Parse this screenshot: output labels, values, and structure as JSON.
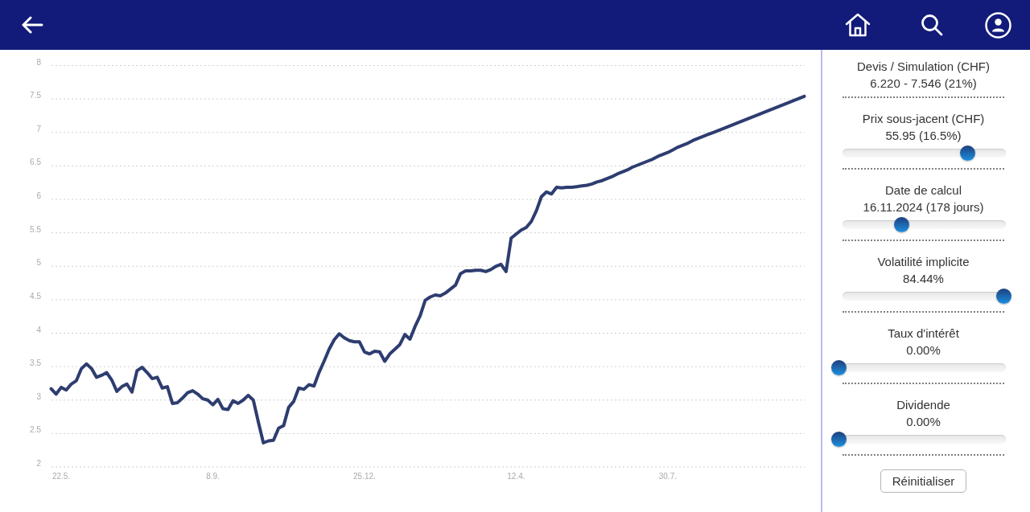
{
  "chart": {
    "chart_data": {
      "type": "line",
      "grid": true,
      "categories": [
        null,
        null,
        "22.5.",
        null,
        null,
        null,
        null,
        null,
        null,
        null,
        null,
        null,
        null,
        null,
        null,
        null,
        null,
        null,
        null,
        null,
        null,
        null,
        null,
        null,
        null,
        null,
        null,
        null,
        null,
        null,
        null,
        null,
        "8.9.",
        null,
        null,
        null,
        null,
        null,
        null,
        null,
        null,
        null,
        null,
        null,
        null,
        null,
        null,
        null,
        null,
        null,
        null,
        null,
        null,
        null,
        null,
        null,
        null,
        null,
        null,
        null,
        null,
        null,
        "25.12.",
        null,
        null,
        null,
        null,
        null,
        null,
        null,
        null,
        null,
        null,
        null,
        null,
        null,
        null,
        null,
        null,
        null,
        null,
        null,
        null,
        null,
        null,
        null,
        null,
        null,
        null,
        null,
        null,
        null,
        "12.4.",
        null,
        null,
        null,
        null,
        null,
        null,
        null,
        null,
        null,
        null,
        null,
        null,
        null,
        null,
        null,
        null,
        null,
        null,
        null,
        null,
        null,
        null,
        null,
        null,
        null,
        null,
        null,
        null,
        null,
        "30.7.",
        null,
        null,
        null,
        null,
        null,
        null,
        null,
        null,
        null,
        null,
        null,
        null,
        null,
        null,
        null,
        null,
        null,
        null,
        null,
        null,
        null,
        null,
        null,
        null,
        null,
        null,
        null
      ],
      "values": [
        3.17,
        3.09,
        3.19,
        3.15,
        3.24,
        3.29,
        3.47,
        3.54,
        3.47,
        3.34,
        3.37,
        3.41,
        3.3,
        3.13,
        3.2,
        3.24,
        3.12,
        3.44,
        3.49,
        3.41,
        3.32,
        3.34,
        3.18,
        3.2,
        2.95,
        2.96,
        3.03,
        3.11,
        3.14,
        3.09,
        3.02,
        3.0,
        2.93,
        3.01,
        2.87,
        2.86,
        2.99,
        2.95,
        3.0,
        3.07,
        3.0,
        2.67,
        2.36,
        2.39,
        2.4,
        2.58,
        2.62,
        2.89,
        2.98,
        3.18,
        3.16,
        3.23,
        3.21,
        3.41,
        3.58,
        3.76,
        3.9,
        3.99,
        3.93,
        3.89,
        3.87,
        3.87,
        3.72,
        3.69,
        3.73,
        3.72,
        3.58,
        3.69,
        3.76,
        3.83,
        3.98,
        3.91,
        4.1,
        4.26,
        4.49,
        4.54,
        4.57,
        4.56,
        4.6,
        4.66,
        4.72,
        4.89,
        4.93,
        4.93,
        4.94,
        4.94,
        4.92,
        4.95,
        5.0,
        5.03,
        4.92,
        5.42,
        5.48,
        5.54,
        5.58,
        5.67,
        5.83,
        6.04,
        6.11,
        6.08,
        6.18,
        6.17,
        6.18,
        6.18,
        6.19,
        6.2,
        6.21,
        6.23,
        6.26,
        6.28,
        6.31,
        6.34,
        6.38,
        6.41,
        6.44,
        6.48,
        6.51,
        6.54,
        6.57,
        6.6,
        6.64,
        6.67,
        6.7,
        6.74,
        6.78,
        6.81,
        6.84,
        6.88,
        6.91,
        6.94,
        6.97,
        7.0,
        7.03,
        7.06,
        7.09,
        7.12,
        7.15,
        7.18,
        7.21,
        7.24,
        7.27,
        7.3,
        7.33,
        7.36,
        7.39,
        7.42,
        7.45,
        7.48,
        7.51,
        7.54
      ],
      "ylim": [
        2,
        8
      ],
      "yticks": [
        2,
        2.5,
        3,
        3.5,
        4,
        4.5,
        5,
        5.5,
        6,
        6.5,
        7,
        7.5,
        8
      ]
    }
  },
  "panel": {
    "sections": [
      {
        "kind": "readout",
        "title": "Devis / Simulation (CHF)",
        "value": "6.220 - 7.546 (21%)"
      },
      {
        "kind": "slider",
        "title": "Prix sous-jacent (CHF)",
        "value": "55.95 (16.5%)",
        "level": 0.78
      },
      {
        "kind": "slider",
        "title": "Date de calcul",
        "value": "16.11.2024 (178 jours)",
        "level": 0.38
      },
      {
        "kind": "slider",
        "title": "Volatilité implicite",
        "value": "84.44%",
        "level": 1.0
      },
      {
        "kind": "slider",
        "title": "Taux d'intérêt",
        "value": "0.00%",
        "level": 0
      },
      {
        "kind": "slider",
        "title": "Dividende",
        "value": "0.00%",
        "level": 0
      }
    ],
    "reset_button": "Réinitialiser"
  }
}
